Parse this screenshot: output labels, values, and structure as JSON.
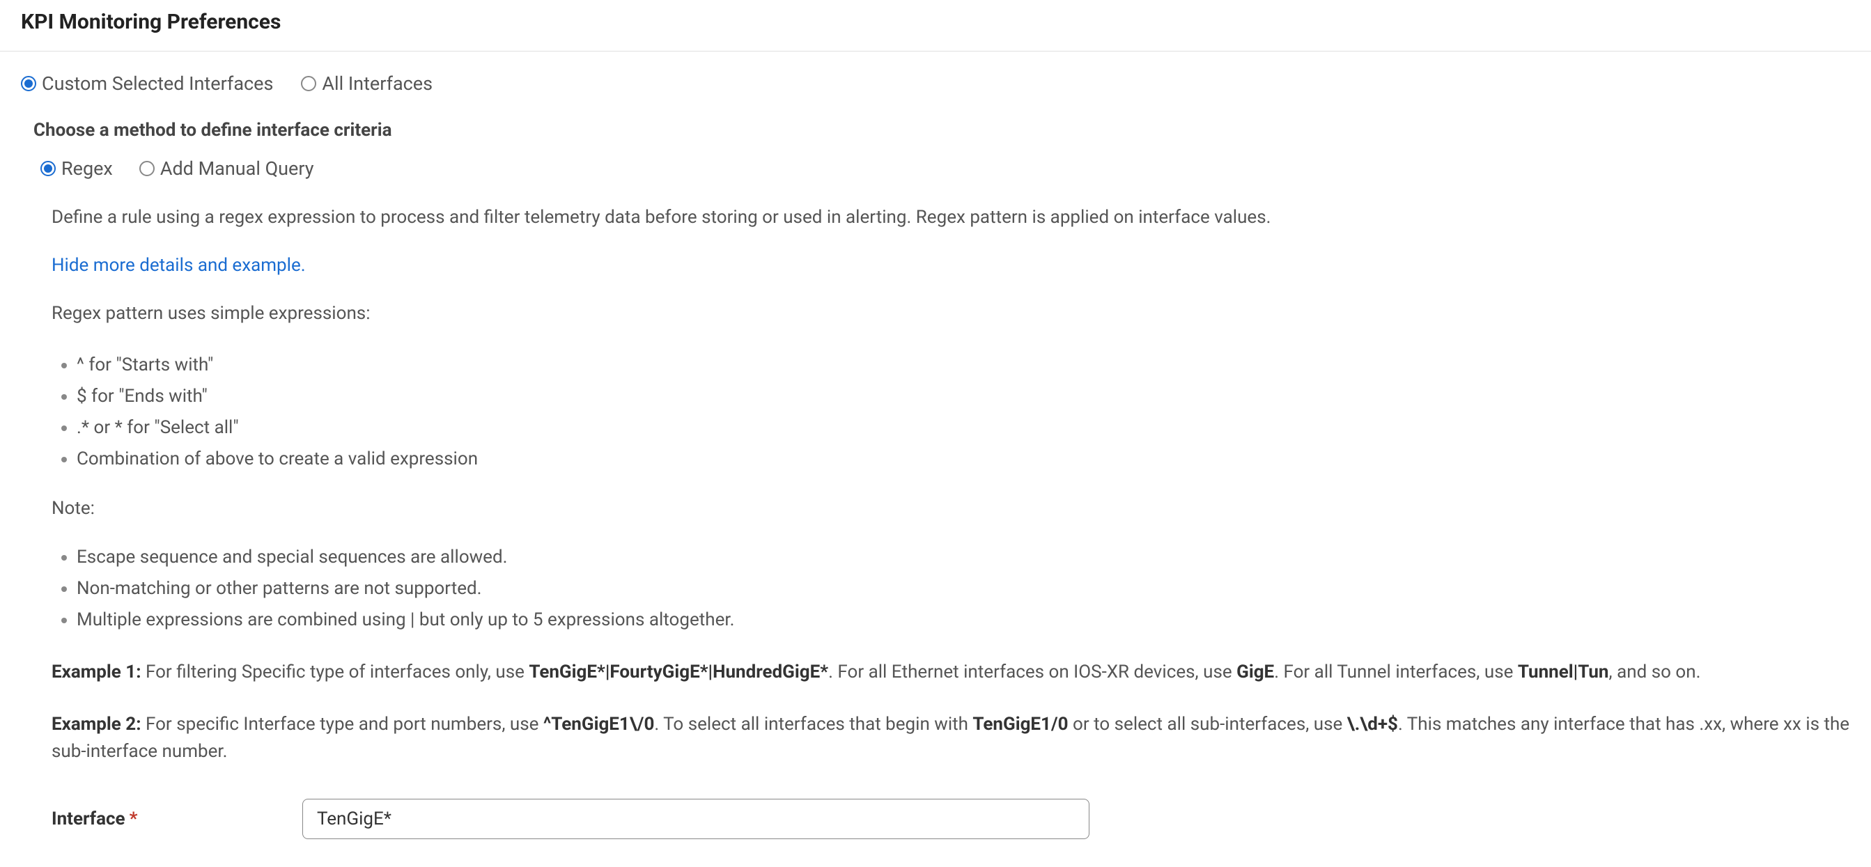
{
  "header": {
    "title": "KPI Monitoring Preferences"
  },
  "scope": {
    "items": [
      {
        "label": "Custom Selected Interfaces",
        "selected": true
      },
      {
        "label": "All Interfaces",
        "selected": false
      }
    ]
  },
  "method": {
    "heading": "Choose a method to define interface criteria",
    "items": [
      {
        "label": "Regex",
        "selected": true
      },
      {
        "label": "Add Manual Query",
        "selected": false
      }
    ]
  },
  "intro": "Define a rule using a regex expression to process and filter telemetry data before storing or used in alerting. Regex pattern is applied on interface values.",
  "hide_link": "Hide more details and example.",
  "details": {
    "lead": "Regex pattern uses simple expressions:",
    "bullets1": [
      "^ for \"Starts with\"",
      "$ for \"Ends with\"",
      ".* or * for \"Select all\"",
      "Combination of above to create a valid expression"
    ],
    "note_label": "Note:",
    "bullets2": [
      "Escape sequence and special sequences are allowed.",
      "Non-matching or other patterns are not supported.",
      "Multiple expressions are combined using | but only up to 5 expressions altogether."
    ]
  },
  "examples": {
    "ex1": {
      "label": "Example 1:",
      "t1": " For filtering Specific type of interfaces only, use ",
      "b1": "TenGigE*|FourtyGigE*|HundredGigE*",
      "t2": ". For all Ethernet interfaces on IOS-XR devices, use ",
      "b2": "GigE",
      "t3": ". For all Tunnel interfaces, use ",
      "b3": "Tunnel|Tun",
      "t4": ", and so on."
    },
    "ex2": {
      "label": "Example 2:",
      "t1": " For specific Interface type and port numbers, use ",
      "b1": "^TenGigE1\\/0",
      "t2": ". To select all interfaces that begin with ",
      "b2": "TenGigE1/0",
      "t3": " or to select all sub-interfaces, use ",
      "b3": "\\.\\d+$",
      "t4": ". This matches any interface that has .xx, where xx is the sub-interface number."
    }
  },
  "field": {
    "label": "Interface",
    "required_marker": "*",
    "value": "TenGigE*"
  }
}
